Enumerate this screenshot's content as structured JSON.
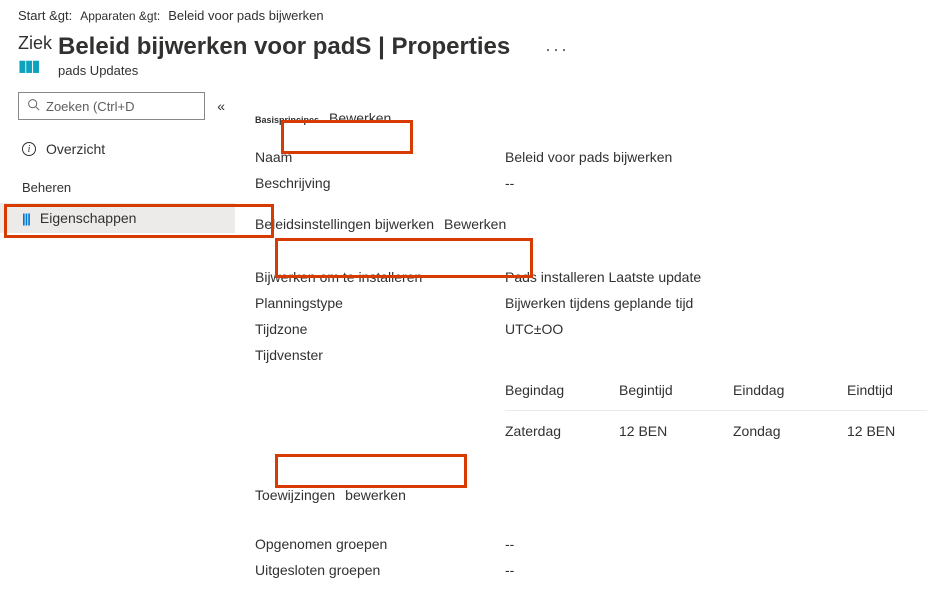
{
  "breadcrumb": {
    "item1": "Start &gt:",
    "item2": "Apparaten &gt:",
    "item3": "Beleid voor pads bijwerken"
  },
  "header": {
    "ziek": "Ziek",
    "title": "Beleid bijwerken voor padS | Properties",
    "subtitle": "pads Updates",
    "more": "···"
  },
  "sidebar": {
    "search_placeholder": "Zoeken (Ctrl+D",
    "overview": "Overzicht",
    "manage_label": "Beheren",
    "properties": "Eigenschappen"
  },
  "sections": {
    "basics": {
      "small": "Basisprincipes",
      "edit": "Bewerken",
      "rows": {
        "name_key": "Naam",
        "name_val": "Beleid voor pads bijwerken",
        "desc_key": "Beschrijving",
        "desc_val": "--"
      }
    },
    "policy": {
      "label": "Beleidsinstellingen bijwerken",
      "edit": "Bewerken",
      "rows": {
        "update_key": "Bijwerken om te installeren",
        "update_val": "Pads installeren Laatste update",
        "plan_key": "Planningstype",
        "plan_val": "Bijwerken tijdens geplande tijd",
        "tz_key": "Tijdzone",
        "tz_val": "UTC±OO",
        "window_key": "Tijdvenster"
      },
      "table": {
        "h1": "Begindag",
        "h2": "Begintijd",
        "h3": "Einddag",
        "h4": "Eindtijd",
        "r1c1": "Zaterdag",
        "r1c2": "12 BEN",
        "r1c3": "Zondag",
        "r1c4": "12 BEN"
      }
    },
    "assignments": {
      "label": "Toewijzingen",
      "edit": "bewerken",
      "rows": {
        "included_key": "Opgenomen groepen",
        "included_val": "--",
        "excluded_key": "Uitgesloten groepen",
        "excluded_val": "--"
      }
    }
  }
}
